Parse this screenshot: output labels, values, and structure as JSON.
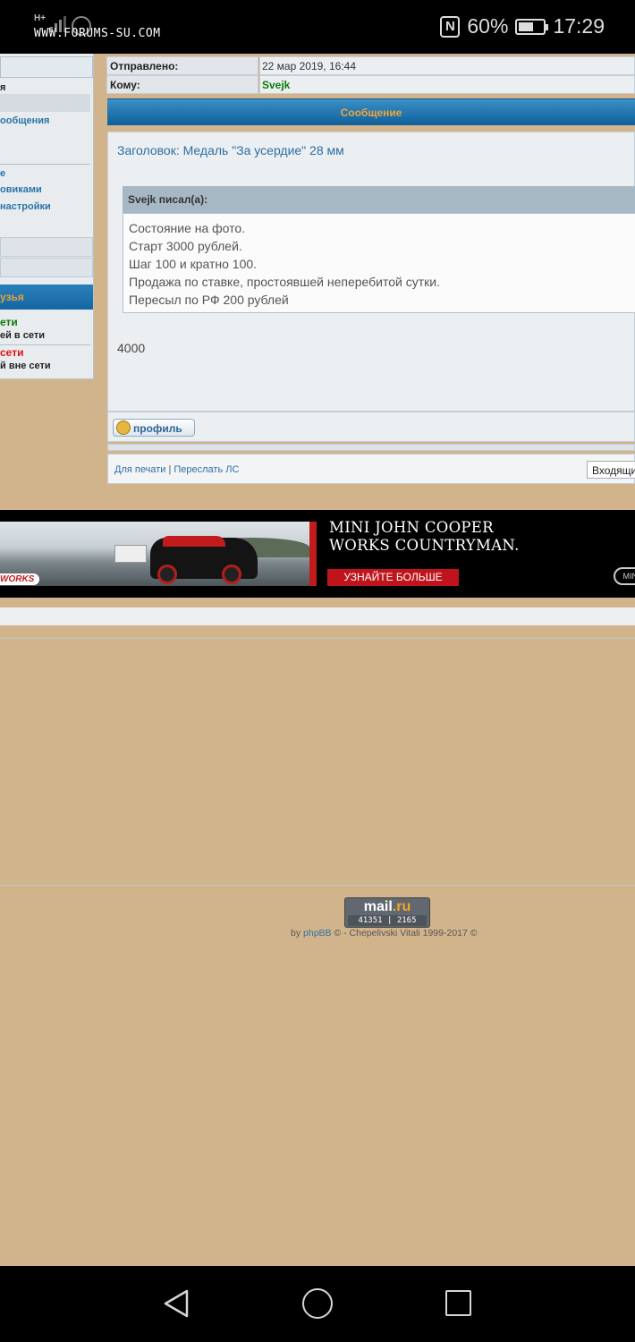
{
  "status_bar": {
    "watermark": "WWW.FORUMS-SU.COM",
    "network": "H+",
    "nfc_icon": "nfc-icon",
    "battery_percent": "60%",
    "battery_level": 0.6,
    "time": "17:29"
  },
  "sidebar": {
    "header": "я",
    "items": [
      "я",
      "ообщения",
      "е",
      "овиками",
      " настройки"
    ],
    "friends_header": "узья",
    "online": "ети",
    "online_sub": "ей в сети",
    "offline": " сети",
    "offline_sub": "й вне сети"
  },
  "message": {
    "sent_label": "Отправлено:",
    "sent_value": "22 мар 2019, 16:44",
    "to_label": "Кому:",
    "to_value": "Svejk",
    "section_title": "Сообщение",
    "subject": "Заголовок: Медаль \"За усердие\" 28 мм",
    "quote_author": "Svejk писал(а):",
    "quote_lines": [
      "Состояние на фото.",
      "Старт 3000 рублей.",
      "Шаг 100 и кратно 100.",
      "Продажа по ставке, простоявшей неперебитой сутки.",
      "Пересыл по РФ 200 рублей"
    ],
    "reply_text": "4000",
    "profile_button": "профиль"
  },
  "footer_links": {
    "print": "Для печати",
    "separator": "|",
    "forward": "Переслать ЛС",
    "folder": "Входящие"
  },
  "ad": {
    "title_line1": "MINI JOHN COOPER",
    "title_line2": "WORKS COUNTRYMAN.",
    "cta": "УЗНАЙТЕ БОЛЬШЕ",
    "works_badge": "WORKS",
    "logo_text": "MINI"
  },
  "counter": {
    "brand": "mail",
    "brand_suffix": ".ru",
    "num1": "41351",
    "num2": "2165"
  },
  "credits": {
    "by": "by",
    "phpbb": "phpBB",
    "rest": "© - Chepelivski Vitali 1999-2017 ©"
  },
  "nav": {
    "back_icon": "back-icon",
    "home_icon": "home-icon",
    "recents_icon": "recents-icon"
  },
  "colors": {
    "page_bg": "#d1b48c",
    "header_blue": "#1566a3",
    "header_text_orange": "#f0a53a",
    "username_green": "#0d7a0d",
    "offline_red": "#e01010",
    "link_blue": "#2f6ea3"
  }
}
